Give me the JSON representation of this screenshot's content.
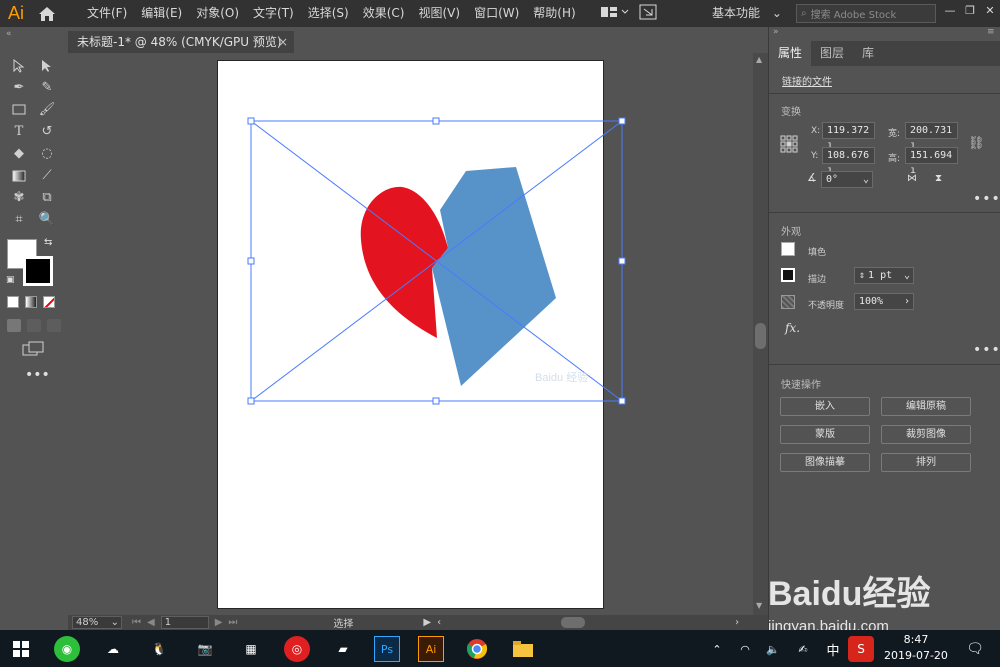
{
  "app": {
    "logo": "Ai",
    "menu": [
      "文件(F)",
      "编辑(E)",
      "对象(O)",
      "文字(T)",
      "选择(S)",
      "效果(C)",
      "视图(V)",
      "窗口(W)",
      "帮助(H)"
    ],
    "workspace_label": "基本功能",
    "stock_search_placeholder": "搜索 Adobe Stock",
    "accent_color": "#ff9a00"
  },
  "document": {
    "tab_title": "未标题-1* @ 48% (CMYK/GPU 预览)",
    "close_glyph": "×"
  },
  "artwork": {
    "red_shape_color": "#e3141f",
    "blue_shape_color": "#5793c9",
    "selection_color": "#4a7bff",
    "artboard_watermark": "Baidu 经验"
  },
  "statusbar": {
    "zoom": "48%",
    "page": "1",
    "tool_name": "选择"
  },
  "right_panel": {
    "tabs": [
      "属性",
      "图层",
      "库"
    ],
    "linked_file_label": "链接的文件",
    "transform": {
      "title": "变换",
      "x_label": "X:",
      "x_value": "119.372 ı",
      "y_label": "Y:",
      "y_value": "108.676 ı",
      "w_label": "宽:",
      "w_value": "200.731 ı",
      "h_label": "高:",
      "h_value": "151.694 ı",
      "angle_value": "0°"
    },
    "appearance": {
      "title": "外观",
      "fill_label": "填色",
      "stroke_label": "描边",
      "stroke_value": "1 pt",
      "opacity_label": "不透明度",
      "opacity_value": "100%",
      "fx_label": "fx."
    },
    "quick_actions": {
      "title": "快速操作",
      "buttons": [
        "嵌入",
        "编辑原稿",
        "蒙版",
        "裁剪图像",
        "图像描摹",
        "排列"
      ]
    }
  },
  "taskbar": {
    "ime": "中",
    "time": "8:47",
    "date": "2019-07-20"
  },
  "watermark": {
    "brand": "Baidu经验",
    "url": "jingyan.baidu.com"
  }
}
